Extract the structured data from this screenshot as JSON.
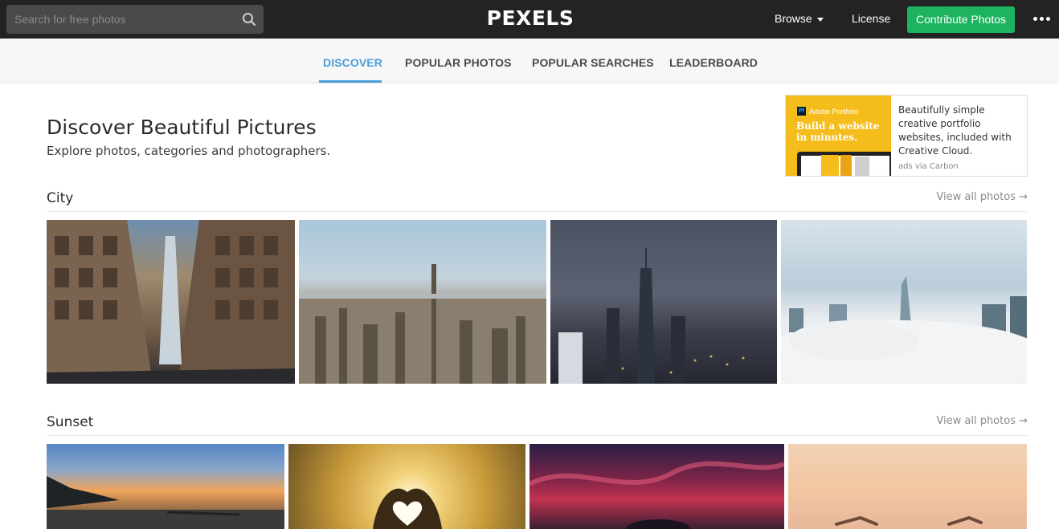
{
  "header": {
    "search_placeholder": "Search for free photos",
    "logo": "PEXELS",
    "browse": "Browse",
    "license": "License",
    "contribute": "Contribute Photos"
  },
  "subnav": {
    "tabs": [
      "DISCOVER",
      "POPULAR PHOTOS",
      "POPULAR SEARCHES",
      "LEADERBOARD"
    ],
    "active": "DISCOVER"
  },
  "hero": {
    "title": "Discover Beautiful Pictures",
    "subtitle": "Explore photos, categories and photographers."
  },
  "ad": {
    "brand": "Adobe Portfolio",
    "brand_badge": "Pf",
    "headline": "Build a website in minutes.",
    "text": "Beautifully simple creative portfolio websites, included with Creative Cloud.",
    "via": "ads via Carbon"
  },
  "sections": [
    {
      "title": "City",
      "view_all": "View all photos →"
    },
    {
      "title": "Sunset",
      "view_all": "View all photos →"
    }
  ],
  "colors": {
    "topbar": "#232323",
    "accent": "#4a9ed9",
    "contribute": "#1db35f"
  }
}
